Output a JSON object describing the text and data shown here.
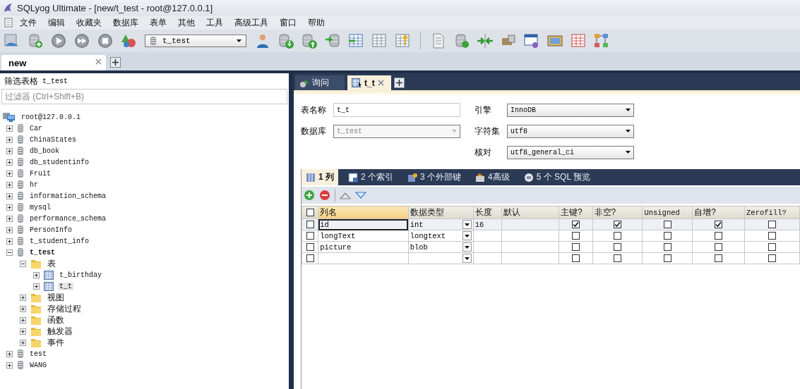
{
  "window": {
    "title": "SQLyog Ultimate - [new/t_test - root@127.0.0.1]"
  },
  "menu": [
    "文件",
    "编辑",
    "收藏夹",
    "数据库",
    "表单",
    "其他",
    "工具",
    "高级工具",
    "窗口",
    "帮助"
  ],
  "toolbar": {
    "database_select": "t_test"
  },
  "doc_tabs": [
    {
      "label": "new",
      "selected": true
    }
  ],
  "sidebar": {
    "filter_label": "筛选表格",
    "filter_database": "t_test",
    "filter_placeholder": "过滤器 (Ctrl+Shift+B)",
    "tree": {
      "label": "root@127.0.0.1",
      "kind": "server",
      "children": [
        {
          "label": "Car",
          "kind": "database",
          "expanded": false,
          "current": false
        },
        {
          "label": "ChinaStates",
          "kind": "database",
          "expanded": false,
          "current": false
        },
        {
          "label": "db_book",
          "kind": "database",
          "expanded": false,
          "current": false
        },
        {
          "label": "db_studentinfo",
          "kind": "database",
          "expanded": false,
          "current": false
        },
        {
          "label": "Fruit",
          "kind": "database",
          "expanded": false,
          "current": false
        },
        {
          "label": "hr",
          "kind": "database",
          "expanded": false,
          "current": false
        },
        {
          "label": "information_schema",
          "kind": "database",
          "expanded": false,
          "current": false
        },
        {
          "label": "mysql",
          "kind": "database",
          "expanded": false,
          "current": false
        },
        {
          "label": "performance_schema",
          "kind": "database",
          "expanded": false,
          "current": false
        },
        {
          "label": "PersonInfo",
          "kind": "database",
          "expanded": false,
          "current": false
        },
        {
          "label": "t_student_info",
          "kind": "database",
          "expanded": false,
          "current": false
        },
        {
          "label": "t_test",
          "kind": "database",
          "expanded": true,
          "current": true,
          "children": [
            {
              "label": "表",
              "kind": "folder",
              "expanded": true,
              "children": [
                {
                  "label": "t_birthday",
                  "kind": "table",
                  "expanded": false,
                  "selected": false
                },
                {
                  "label": "t_t",
                  "kind": "table",
                  "expanded": false,
                  "selected": true
                }
              ]
            },
            {
              "label": "视图",
              "kind": "folder",
              "expanded": false
            },
            {
              "label": "存储过程",
              "kind": "folder",
              "expanded": false
            },
            {
              "label": "函数",
              "kind": "folder",
              "expanded": false
            },
            {
              "label": "触发器",
              "kind": "folder",
              "expanded": false
            },
            {
              "label": "事件",
              "kind": "folder",
              "expanded": false
            }
          ]
        },
        {
          "label": "test",
          "kind": "database",
          "expanded": false,
          "current": false
        },
        {
          "label": "WANG",
          "kind": "database",
          "expanded": false,
          "current": false
        }
      ]
    }
  },
  "query_tabs": [
    {
      "label": "询问",
      "kind": "query",
      "selected": false
    },
    {
      "label": "t_t",
      "kind": "table",
      "selected": true
    }
  ],
  "form": {
    "table_name": {
      "label": "表名称",
      "value": "t_t"
    },
    "database": {
      "label": "数据库",
      "value": "t_test",
      "disabled": true
    },
    "engine": {
      "label": "引擎",
      "value": "InnoDB"
    },
    "charset": {
      "label": "字符集",
      "value": "utf8"
    },
    "collation": {
      "label": "核对",
      "value": "utf8_general_ci"
    }
  },
  "sub_tabs": [
    {
      "label": "1 列",
      "kind": "columns",
      "selected": true
    },
    {
      "label": "2 个索引",
      "kind": "indexes",
      "selected": false
    },
    {
      "label": "3 个外部键",
      "kind": "foreign_keys",
      "selected": false
    },
    {
      "label": "4高级",
      "kind": "advanced",
      "selected": false
    },
    {
      "label": "5 个 SQL 预览",
      "kind": "sql",
      "selected": false
    }
  ],
  "table": {
    "select_all": {
      "checked": false
    },
    "columns": [
      {
        "label": "列名",
        "kind": "text",
        "selected": true
      },
      {
        "label": "数据类型",
        "kind": "dropdown",
        "selected": false
      },
      {
        "label": "长度",
        "kind": "text",
        "selected": false
      },
      {
        "label": "默认",
        "kind": "text",
        "selected": false
      },
      {
        "label": "主键?",
        "kind": "check",
        "selected": false
      },
      {
        "label": "非空?",
        "kind": "check",
        "selected": false
      },
      {
        "label": "Unsigned",
        "kind": "check",
        "selected": false
      },
      {
        "label": "自增?",
        "kind": "check",
        "selected": false
      },
      {
        "label": "Zerofill?",
        "kind": "check",
        "selected": false
      }
    ],
    "rows": [
      {
        "checked": false,
        "selected": true,
        "cells": [
          "id",
          "int",
          "16",
          null,
          true,
          true,
          false,
          true,
          false
        ]
      },
      {
        "checked": false,
        "selected": false,
        "cells": [
          "longText",
          "longtext",
          null,
          null,
          false,
          false,
          false,
          false,
          false
        ]
      },
      {
        "checked": false,
        "selected": false,
        "cells": [
          "picture",
          "blob",
          null,
          null,
          false,
          false,
          false,
          false,
          false
        ]
      },
      {
        "checked": false,
        "selected": false,
        "cells": [
          null,
          null,
          null,
          null,
          false,
          false,
          false,
          false,
          false
        ]
      }
    ]
  }
}
